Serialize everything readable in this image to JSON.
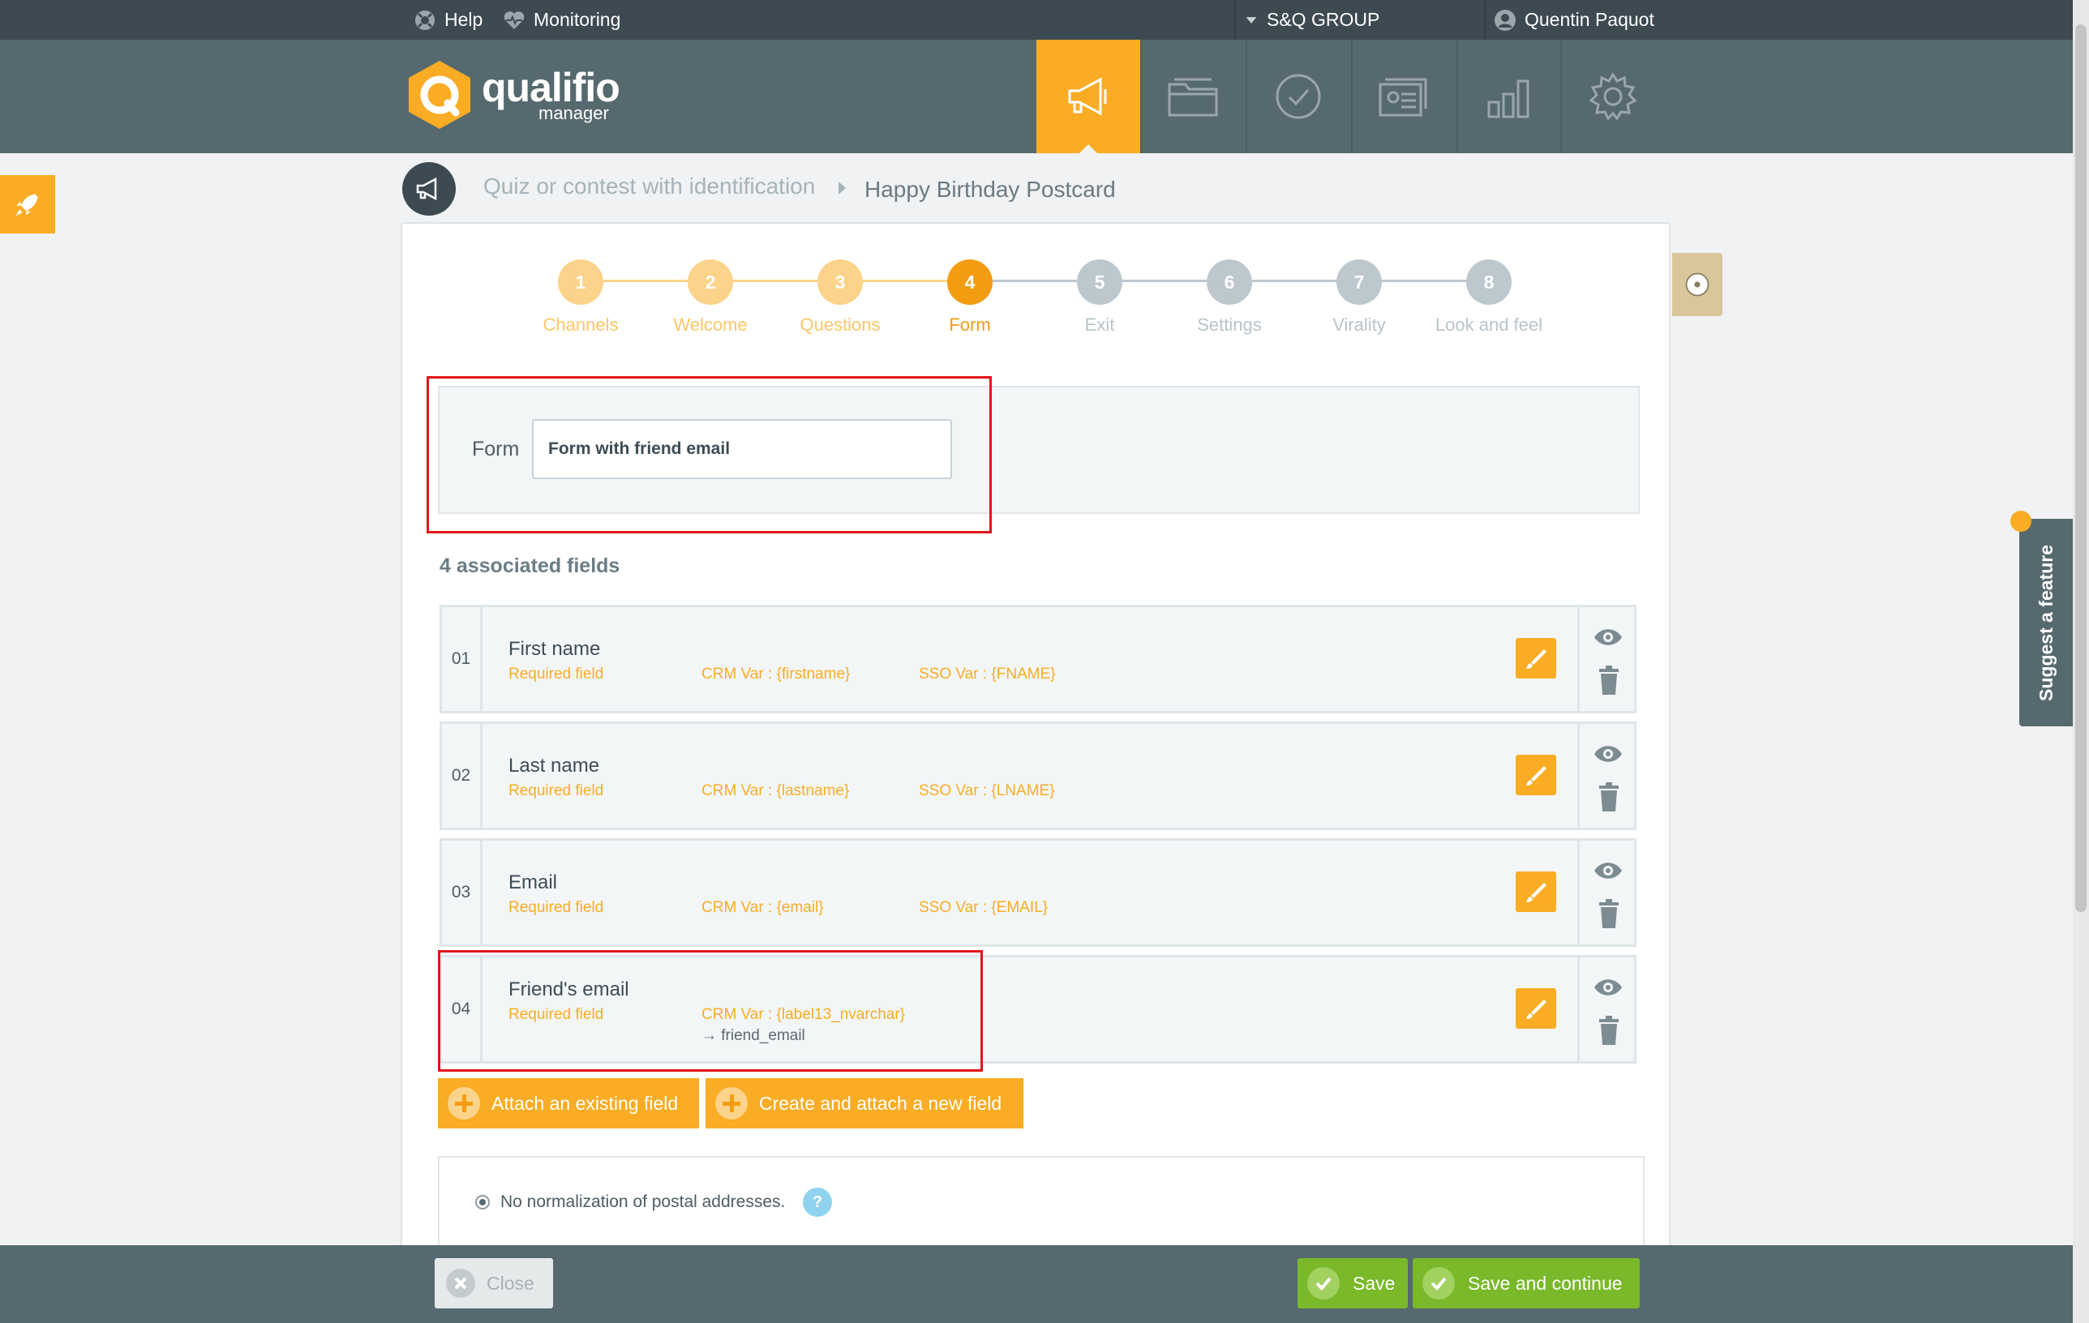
{
  "topbar": {
    "help": "Help",
    "monitoring": "Monitoring",
    "org": "S&Q GROUP",
    "user": "Quentin Paquot"
  },
  "logo": {
    "name": "qualifio",
    "sub": "manager"
  },
  "nav": [
    {
      "icon": "megaphone-icon",
      "active": true
    },
    {
      "icon": "folder-icon",
      "active": false
    },
    {
      "icon": "check-circle-icon",
      "active": false
    },
    {
      "icon": "id-cards-icon",
      "active": false
    },
    {
      "icon": "bar-chart-icon",
      "active": false
    },
    {
      "icon": "gear-icon",
      "active": false
    }
  ],
  "breadcrumb": {
    "type": "Quiz or contest with identification",
    "campaign": "Happy Birthday Postcard"
  },
  "steps": [
    {
      "num": "1",
      "label": "Channels",
      "state": "done"
    },
    {
      "num": "2",
      "label": "Welcome",
      "state": "done"
    },
    {
      "num": "3",
      "label": "Questions",
      "state": "done"
    },
    {
      "num": "4",
      "label": "Form",
      "state": "current"
    },
    {
      "num": "5",
      "label": "Exit",
      "state": "todo"
    },
    {
      "num": "6",
      "label": "Settings",
      "state": "todo"
    },
    {
      "num": "7",
      "label": "Virality",
      "state": "todo"
    },
    {
      "num": "8",
      "label": "Look and feel",
      "state": "todo"
    }
  ],
  "form": {
    "label": "Form",
    "value": "Form with friend email"
  },
  "associated_title": "4 associated fields",
  "fields": [
    {
      "num": "01",
      "name": "First name",
      "required": "Required field",
      "crm": "CRM Var : {firstname}",
      "sso": "SSO Var : {FNAME}",
      "map": ""
    },
    {
      "num": "02",
      "name": "Last name",
      "required": "Required field",
      "crm": "CRM Var : {lastname}",
      "sso": "SSO Var : {LNAME}",
      "map": ""
    },
    {
      "num": "03",
      "name": "Email",
      "required": "Required field",
      "crm": "CRM Var : {email}",
      "sso": "SSO Var : {EMAIL}",
      "map": ""
    },
    {
      "num": "04",
      "name": "Friend's email",
      "required": "Required field",
      "crm": "CRM Var : {label13_nvarchar}",
      "sso": "",
      "map": "→ friend_email"
    }
  ],
  "buttons": {
    "attach_existing": "Attach an existing field",
    "create_attach": "Create and attach a new field",
    "close": "Close",
    "save": "Save",
    "save_continue": "Save and continue"
  },
  "normalization": {
    "text": "No normalization of postal addresses.",
    "help": "?"
  },
  "suggest": "Suggest a feature",
  "colors": {
    "accent": "#f9ac24",
    "header": "#56696f",
    "topbar": "#3d4a52",
    "green": "#79b92a",
    "highlight": "#e2141b"
  }
}
